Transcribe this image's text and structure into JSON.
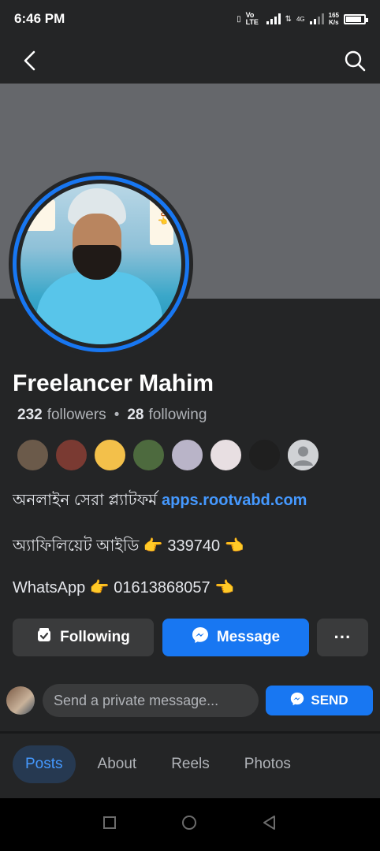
{
  "status_bar": {
    "time": "6:46 PM",
    "network_label": "Vo LTE",
    "net2_label": "4G",
    "speed_value": "165",
    "speed_unit": "K/s",
    "battery_level": 0.85
  },
  "topbar": {
    "back_icon": "back-arrow-icon",
    "search_icon": "search-icon"
  },
  "profile": {
    "name": "Freelancer Mahim",
    "followers_count": "232",
    "followers_label": "followers",
    "separator": "•",
    "following_count": "28",
    "following_label": "following",
    "avatar_sign_left": "ader",
    "avatar_sign_right": "39740👈"
  },
  "friends": [
    {
      "name": "friend-1",
      "color": "#6b5a4a"
    },
    {
      "name": "friend-2",
      "color": "#7a3a32"
    },
    {
      "name": "friend-3",
      "color": "#f3c04a"
    },
    {
      "name": "friend-4",
      "color": "#4d6a3e"
    },
    {
      "name": "friend-5",
      "color": "#b9b4c8"
    },
    {
      "name": "friend-6",
      "color": "#e8dfe2"
    },
    {
      "name": "friend-7",
      "color": "#1f1f1f"
    },
    {
      "name": "friend-8",
      "color": "#d0d2d5"
    }
  ],
  "bio": {
    "line1_text": "অনলাইন সেরা প্ল্যাটফর্ম",
    "line1_link": "apps.rootvabd.com",
    "line2": "অ্যাফিলিয়েট আইডি 👉 339740 👈",
    "line3": "WhatsApp 👉 01613868057 👈"
  },
  "actions": {
    "following_label": "Following",
    "message_label": "Message",
    "more_label": "···"
  },
  "composer": {
    "placeholder": "Send a private message...",
    "send_label": "SEND"
  },
  "tabs": [
    {
      "label": "Posts",
      "active": true
    },
    {
      "label": "About",
      "active": false
    },
    {
      "label": "Reels",
      "active": false
    },
    {
      "label": "Photos",
      "active": false
    }
  ],
  "colors": {
    "background": "#242526",
    "accent": "#1877f2",
    "link": "#4599ff",
    "cover": "#65676b"
  }
}
